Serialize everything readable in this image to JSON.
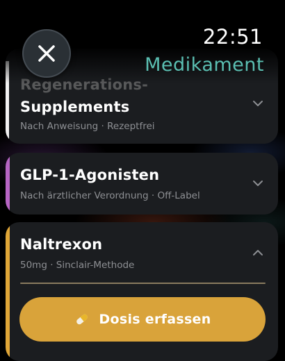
{
  "status_bar": {
    "time": "22:51"
  },
  "header": {
    "title": "Medikament"
  },
  "colors": {
    "accent_title": "#5bbfb2",
    "stripe_regeneration": "#f2f2f2",
    "stripe_glp1": "#b765c4",
    "stripe_naltrexon": "#e0a637",
    "dose_button": "#d9a33a"
  },
  "medications": [
    {
      "title_line1": "Regenerations-",
      "title_line2": "Supplements",
      "subtitle": "Nach Anweisung · Rezeptfrei",
      "expanded": false
    },
    {
      "title": "GLP-1-Agonisten",
      "subtitle": "Nach ärztlicher Verordnung · Off-Label",
      "expanded": false
    },
    {
      "title": "Naltrexon",
      "subtitle": "50mg · Sinclair-Methode",
      "expanded": true
    }
  ],
  "dose_button": {
    "label": "Dosis erfassen",
    "icon": "pill-icon"
  },
  "icons": {
    "close": "close-icon",
    "collapsed": "chevron-down-icon",
    "expanded": "chevron-up-icon"
  }
}
